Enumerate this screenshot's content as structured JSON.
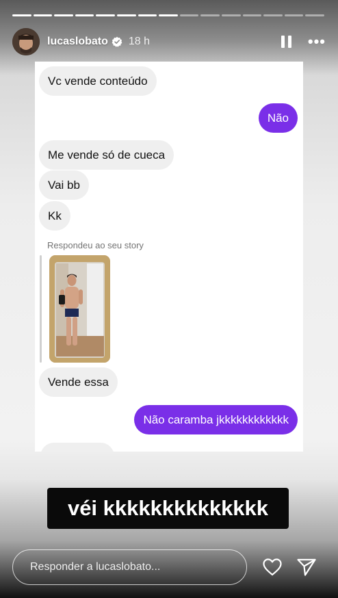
{
  "story": {
    "progress_total": 15,
    "progress_done": 8,
    "username": "lucaslobato",
    "verified": true,
    "time": "18 h",
    "pause_icon": "pause-icon",
    "more_icon": "more-horizontal-icon"
  },
  "chat": {
    "messages": [
      {
        "direction": "incoming",
        "text": "Vc vende conteúdo"
      },
      {
        "direction": "outgoing",
        "text": "Não"
      },
      {
        "direction": "incoming",
        "text": "Me vende só de cueca"
      },
      {
        "direction": "incoming",
        "text": "Vai bb"
      },
      {
        "direction": "incoming",
        "text": "Kk"
      },
      {
        "direction": "incoming",
        "text": "Vende essa"
      },
      {
        "direction": "outgoing",
        "text": "Não caramba jkkkkkkkkkkkk"
      }
    ],
    "reply_label": "Respondeu ao seu story",
    "outgoing_color": "#7a2fe8",
    "incoming_color": "#efefef"
  },
  "caption": "véi kkkkkkkkkkkkkk",
  "footer": {
    "reply_placeholder": "Responder a lucaslobato...",
    "like_icon": "heart-icon",
    "send_icon": "send-icon"
  }
}
